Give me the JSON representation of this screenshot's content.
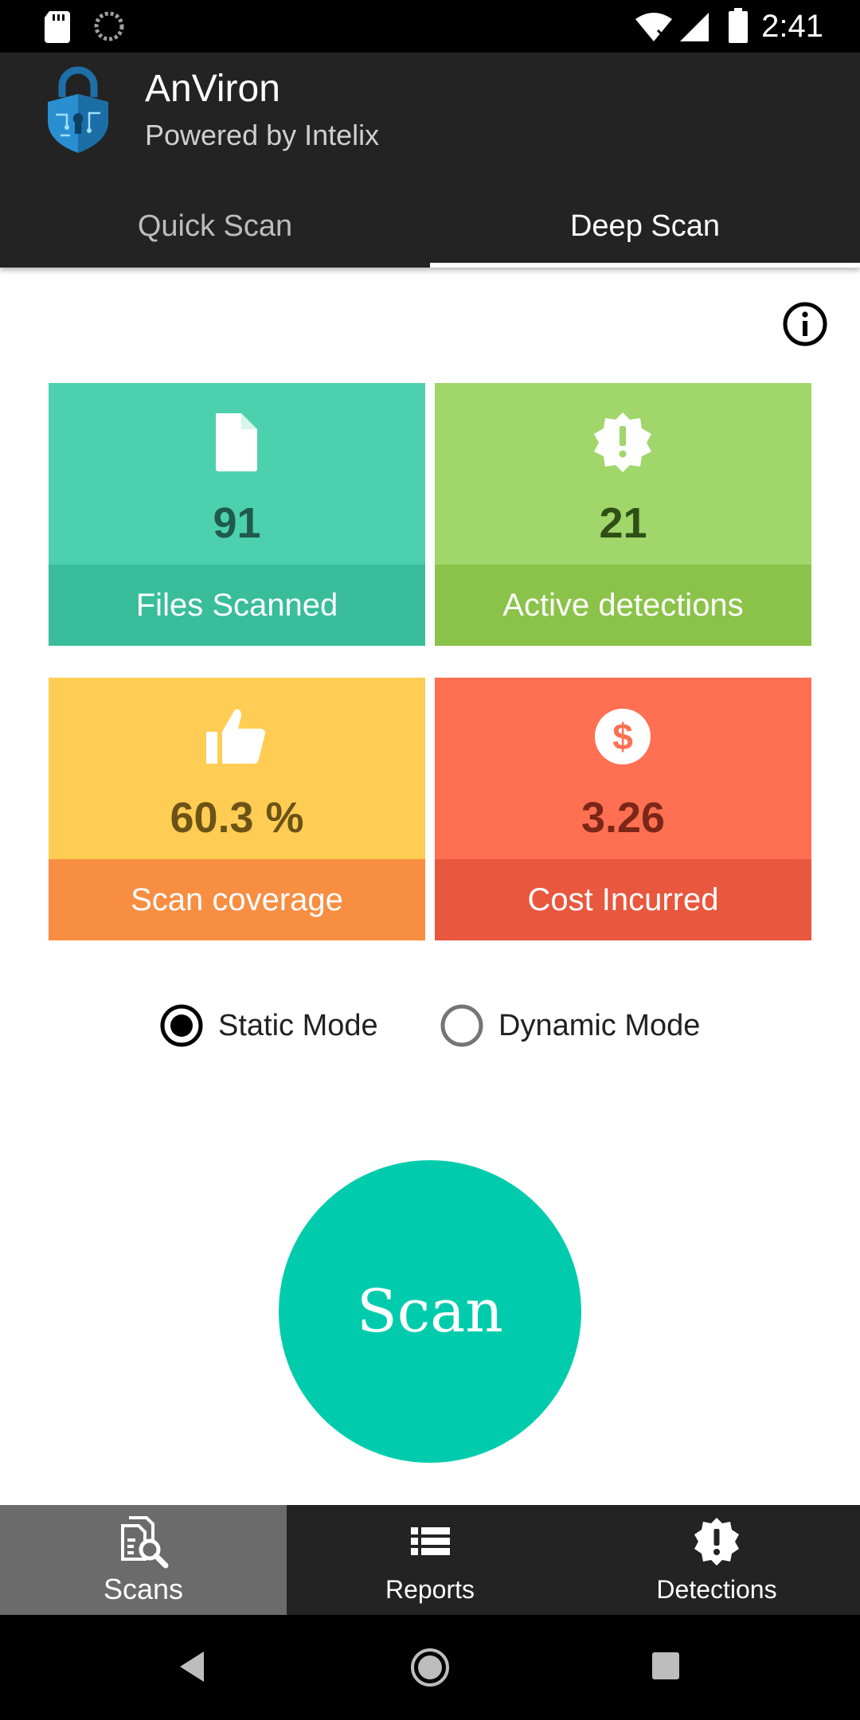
{
  "status_bar": {
    "time": "2:41"
  },
  "app": {
    "title": "AnViron",
    "subtitle": "Powered by Intelix"
  },
  "tabs": [
    {
      "label": "Quick Scan",
      "selected": false
    },
    {
      "label": "Deep Scan",
      "selected": true
    }
  ],
  "stats": [
    {
      "icon": "file-icon",
      "value": "91",
      "label": "Files Scanned",
      "top_color": "#4dd0ad",
      "bottom_color": "#39bd9b"
    },
    {
      "icon": "alert-badge-icon",
      "value": "21",
      "label": "Active detections",
      "top_color": "#a0d66a",
      "bottom_color": "#8bc34a"
    },
    {
      "icon": "thumbs-up-icon",
      "value": "60.3 %",
      "label": "Scan coverage",
      "top_color": "#ffcd53",
      "bottom_color": "#f78e42"
    },
    {
      "icon": "dollar-icon",
      "value": "3.26",
      "label": "Cost Incurred",
      "top_color": "#ff7052",
      "bottom_color": "#e8573e"
    }
  ],
  "modes": [
    {
      "label": "Static Mode",
      "selected": true
    },
    {
      "label": "Dynamic Mode",
      "selected": false
    }
  ],
  "scan_button": {
    "label": "Scan",
    "color": "#00ccad"
  },
  "bottom_nav": [
    {
      "label": "Scans",
      "icon": "scans-search-icon",
      "active": true
    },
    {
      "label": "Reports",
      "icon": "list-icon",
      "active": false
    },
    {
      "label": "Detections",
      "icon": "alert-badge-icon",
      "active": false
    }
  ]
}
